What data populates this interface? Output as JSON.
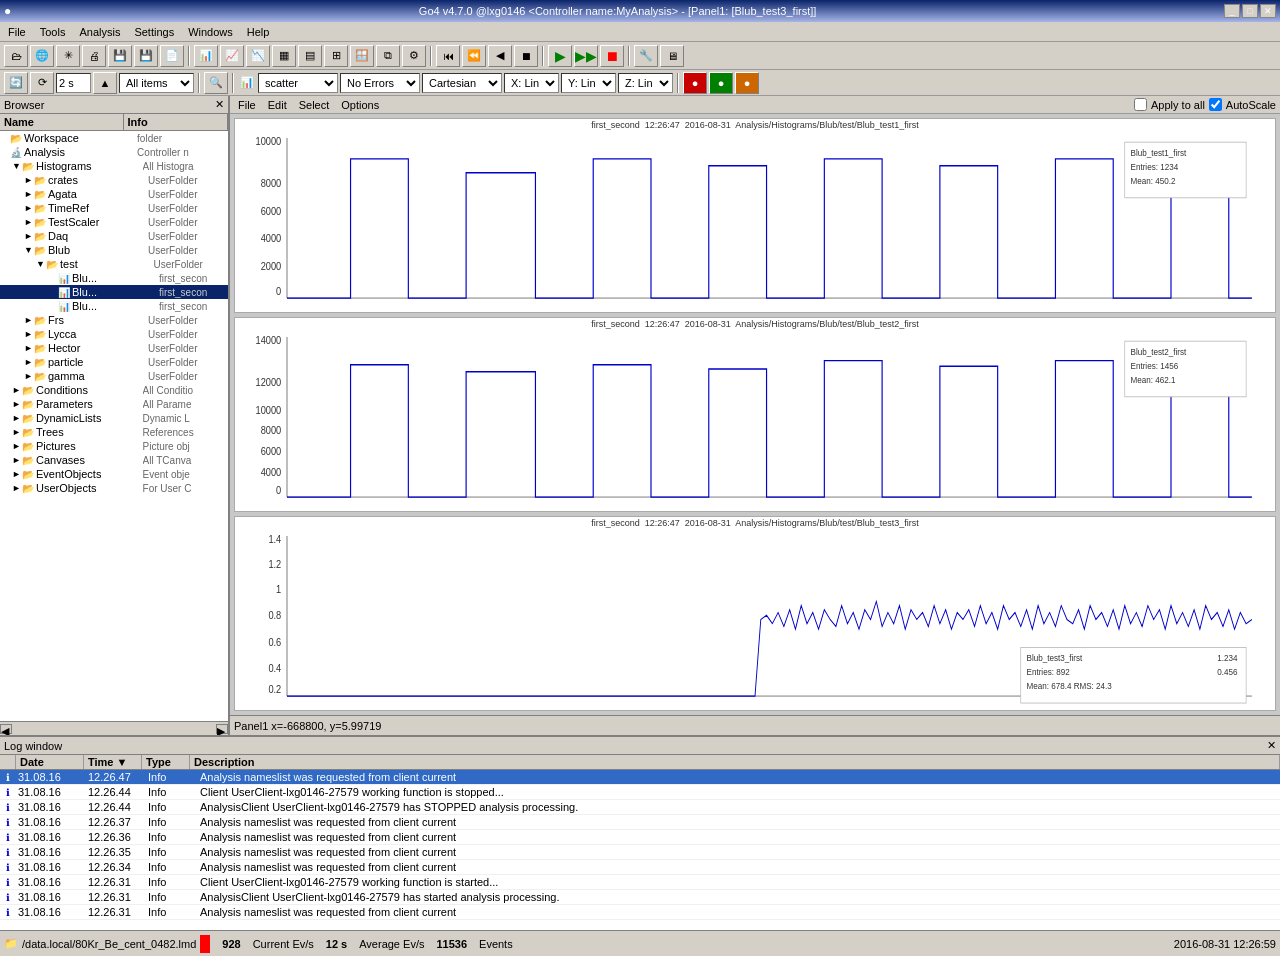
{
  "window": {
    "title": "Go4 v4.7.0 @lxg0146 <Controller name:MyAnalysis> - [Panel1: [Blub_test3_first]]",
    "icon": "●"
  },
  "menubar": {
    "items": [
      "File",
      "Tools",
      "Analysis",
      "Settings",
      "Windows",
      "Help"
    ]
  },
  "toolbar2": {
    "refresh_label": "2 s",
    "items_label": "All items",
    "scatter_label": "scatter",
    "errors_label": "No Errors",
    "cartesian_label": "Cartesian",
    "x_label": "X: Lin",
    "y_label": "Y: Lin",
    "z_label": "Z: Lin",
    "apply_to_all": "Apply to all",
    "autoscale": "AutoScale"
  },
  "browser": {
    "title": "Browser",
    "col_name": "Name",
    "col_info": "Info",
    "tree_items": [
      {
        "id": "workspace",
        "indent": 0,
        "icon": "📁",
        "expand": "",
        "name": "Workspace",
        "info": "folder"
      },
      {
        "id": "analysis",
        "indent": 0,
        "icon": "🔬",
        "expand": "",
        "name": "Analysis",
        "info": "Controller n"
      },
      {
        "id": "histograms",
        "indent": 1,
        "icon": "📂",
        "expand": "▼",
        "name": "Histograms",
        "info": "All Histogra"
      },
      {
        "id": "crates",
        "indent": 2,
        "icon": "📂",
        "expand": "►",
        "name": "crates",
        "info": "UserFolder"
      },
      {
        "id": "agata",
        "indent": 2,
        "icon": "📂",
        "expand": "►",
        "name": "Agata",
        "info": "UserFolder"
      },
      {
        "id": "timeref",
        "indent": 2,
        "icon": "📂",
        "expand": "►",
        "name": "TimeRef",
        "info": "UserFolder"
      },
      {
        "id": "testscaler",
        "indent": 2,
        "icon": "📂",
        "expand": "►",
        "name": "TestScaler",
        "info": "UserFolder"
      },
      {
        "id": "daq",
        "indent": 2,
        "icon": "📂",
        "expand": "►",
        "name": "Daq",
        "info": "UserFolder"
      },
      {
        "id": "blub",
        "indent": 2,
        "icon": "📂",
        "expand": "▼",
        "name": "Blub",
        "info": "UserFolder"
      },
      {
        "id": "test",
        "indent": 3,
        "icon": "📂",
        "expand": "▼",
        "name": "test",
        "info": "UserFolder"
      },
      {
        "id": "blub1",
        "indent": 4,
        "icon": "📊",
        "expand": "",
        "name": "Blu...",
        "info": "first_secon",
        "selected": false
      },
      {
        "id": "blub2",
        "indent": 4,
        "icon": "📊",
        "expand": "",
        "name": "Blu...",
        "info": "first_secon",
        "selected": true
      },
      {
        "id": "blub3",
        "indent": 4,
        "icon": "📊",
        "expand": "",
        "name": "Blu...",
        "info": "first_secon",
        "selected": false
      },
      {
        "id": "frs",
        "indent": 2,
        "icon": "📂",
        "expand": "►",
        "name": "Frs",
        "info": "UserFolder"
      },
      {
        "id": "lycca",
        "indent": 2,
        "icon": "📂",
        "expand": "►",
        "name": "Lycca",
        "info": "UserFolder"
      },
      {
        "id": "hector",
        "indent": 2,
        "icon": "📂",
        "expand": "►",
        "name": "Hector",
        "info": "UserFolder"
      },
      {
        "id": "particle",
        "indent": 2,
        "icon": "📂",
        "expand": "►",
        "name": "particle",
        "info": "UserFolder"
      },
      {
        "id": "gamma",
        "indent": 2,
        "icon": "📂",
        "expand": "►",
        "name": "gamma",
        "info": "UserFolder"
      },
      {
        "id": "conditions",
        "indent": 1,
        "icon": "📂",
        "expand": "►",
        "name": "Conditions",
        "info": "All Conditio"
      },
      {
        "id": "parameters",
        "indent": 1,
        "icon": "📂",
        "expand": "►",
        "name": "Parameters",
        "info": "All Parame"
      },
      {
        "id": "dynamiclists",
        "indent": 1,
        "icon": "📂",
        "expand": "►",
        "name": "DynamicLists",
        "info": "Dynamic L"
      },
      {
        "id": "trees",
        "indent": 1,
        "icon": "📂",
        "expand": "►",
        "name": "Trees",
        "info": "References"
      },
      {
        "id": "pictures",
        "indent": 1,
        "icon": "🖼",
        "expand": "►",
        "name": "Pictures",
        "info": "Picture obj"
      },
      {
        "id": "canvases",
        "indent": 1,
        "icon": "📋",
        "expand": "►",
        "name": "Canvases",
        "info": "All TCanva"
      },
      {
        "id": "eventobjects",
        "indent": 1,
        "icon": "📂",
        "expand": "►",
        "name": "EventObjects",
        "info": "Event obje"
      },
      {
        "id": "userobjects",
        "indent": 1,
        "icon": "📂",
        "expand": "►",
        "name": "UserObjects",
        "info": "For User C"
      }
    ]
  },
  "canvas": {
    "menu_items": [
      "File",
      "Edit",
      "Select",
      "Options"
    ],
    "apply_to_all": "Apply to all",
    "autoscale": "✓ AutoScale",
    "panel_name": "Panel1",
    "histograms": [
      {
        "id": "hist1",
        "title": "first_second  12:26:47  2016-08-31  Analysis/Histograms/Blub/test/Blub_test1_first",
        "max_y": 10000,
        "color": "#0000cc"
      },
      {
        "id": "hist2",
        "title": "first_second  12:26:47  2016-08-31  Analysis/Histograms/Blub/test/Blub_test2_first",
        "max_y": 14000,
        "color": "#0000cc"
      },
      {
        "id": "hist3",
        "title": "first_second  12:26:47  2016-08-31  Analysis/Histograms/Blub/test/Blub_test3_first",
        "max_y": 1.4,
        "color": "#0000cc"
      }
    ],
    "statusbar": "Panel1  x=-668800, y=5.99719"
  },
  "logwindow": {
    "title": "Log window",
    "columns": [
      "Date",
      "Time",
      "Type",
      "Description"
    ],
    "rows": [
      {
        "icon": "ℹ",
        "date": "31.08.16",
        "time": "12.26.47",
        "type": "Info",
        "desc": "Analysis nameslist was requested from client current",
        "highlighted": true
      },
      {
        "icon": "ℹ",
        "date": "31.08.16",
        "time": "12.26.44",
        "type": "Info",
        "desc": "Client UserClient-lxg0146-27579 working function is stopped..."
      },
      {
        "icon": "ℹ",
        "date": "31.08.16",
        "time": "12.26.44",
        "type": "Info",
        "desc": "AnalysisClient UserClient-lxg0146-27579 has STOPPED analysis processing."
      },
      {
        "icon": "ℹ",
        "date": "31.08.16",
        "time": "12.26.37",
        "type": "Info",
        "desc": "Analysis nameslist was requested from client current"
      },
      {
        "icon": "ℹ",
        "date": "31.08.16",
        "time": "12.26.36",
        "type": "Info",
        "desc": "Analysis nameslist was requested from client current"
      },
      {
        "icon": "ℹ",
        "date": "31.08.16",
        "time": "12.26.35",
        "type": "Info",
        "desc": "Analysis nameslist was requested from client current"
      },
      {
        "icon": "ℹ",
        "date": "31.08.16",
        "time": "12.26.34",
        "type": "Info",
        "desc": "Analysis nameslist was requested from client current"
      },
      {
        "icon": "ℹ",
        "date": "31.08.16",
        "time": "12.26.31",
        "type": "Info",
        "desc": "Client UserClient-lxg0146-27579 working function is started..."
      },
      {
        "icon": "ℹ",
        "date": "31.08.16",
        "time": "12.26.31",
        "type": "Info",
        "desc": "AnalysisClient UserClient-lxg0146-27579 has started analysis processing."
      },
      {
        "icon": "ℹ",
        "date": "31.08.16",
        "time": "12.26.31",
        "type": "Info",
        "desc": "Analysis nameslist was requested from client current"
      }
    ]
  },
  "bottomstatus": {
    "file": "/data.local/80Kr_Be_cent_0482.lmd",
    "current_evs_label": "Current Ev/s",
    "current_evs_value": "928",
    "average_evs_label": "Average Ev/s",
    "average_evs_value": "12 s",
    "events_label": "Events",
    "events_value": "11536",
    "timestamp": "2016-08-31 12:26:59"
  }
}
